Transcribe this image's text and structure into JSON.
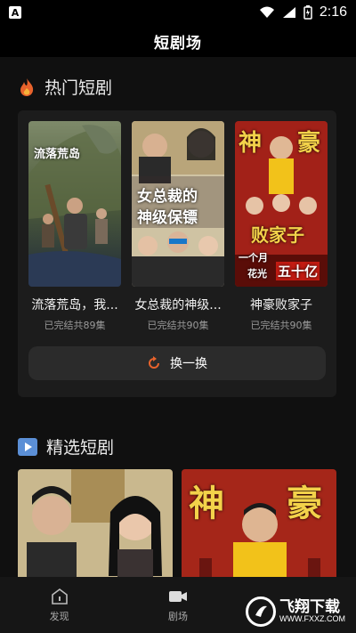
{
  "status": {
    "time": "2:16"
  },
  "header": {
    "title": "短剧场"
  },
  "hot": {
    "section_title": "热门短剧",
    "items": [
      {
        "title": "流落荒岛，我...",
        "subtitle": "已完结共89集",
        "poster_text": "流落荒岛"
      },
      {
        "title": "女总裁的神级...",
        "subtitle": "已完结共90集",
        "poster_text_1": "女总裁的",
        "poster_text_2": "神级保镖"
      },
      {
        "title": "神豪败家子",
        "subtitle": "已完结共90集",
        "poster_text_1": "神",
        "poster_text_2": "豪",
        "poster_text_3": "败家子",
        "poster_text_4": "一个月",
        "poster_text_5": "花光",
        "poster_text_6": "五十亿"
      }
    ],
    "refresh_label": "换一换"
  },
  "featured": {
    "section_title": "精选短剧",
    "poster2_text_1": "神",
    "poster2_text_2": "豪"
  },
  "tabs": [
    {
      "label": "发现",
      "icon": "discover-icon"
    },
    {
      "label": "剧场",
      "icon": "theater-icon"
    }
  ],
  "watermark": {
    "cn": "飞翔下载",
    "en": "WWW.FXXZ.COM"
  },
  "colors": {
    "accent": "#e8632c",
    "background": "#101010",
    "card": "#1c1c1c"
  }
}
